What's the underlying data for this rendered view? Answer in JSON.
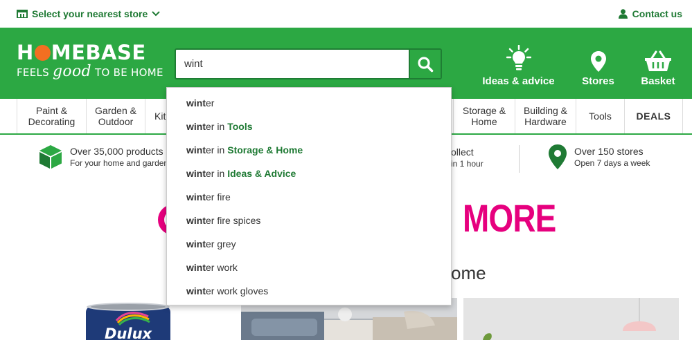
{
  "topbar": {
    "store_select": "Select your nearest store",
    "contact": "Contact us"
  },
  "logo": {
    "brand_h": "H",
    "brand_rest": "MEBASE",
    "tag_feels": "FEELS",
    "tag_good": "good",
    "tag_rest": "TO BE HOME"
  },
  "search": {
    "value": "wint",
    "placeholder": ""
  },
  "header_links": {
    "ideas": "Ideas & advice",
    "stores": "Stores",
    "basket": "Basket"
  },
  "nav": {
    "items": [
      "Paint & Decorating",
      "Garden & Outdoor",
      "Kit",
      "Storage & Home",
      "Building & Hardware",
      "Tools",
      "DEALS"
    ]
  },
  "info": {
    "products_title": "Over 35,000 products",
    "products_sub": "For your home and garden",
    "collect_title": "ollect",
    "collect_sub": "in 1 hour",
    "stores_title": "Over 150 stores",
    "stores_sub": "Open 7 days a week"
  },
  "promo": {
    "more": "MORE",
    "sub": "ome"
  },
  "paint_brand": "Dulux",
  "suggestions": [
    {
      "match": "wint",
      "rest": "er",
      "category": ""
    },
    {
      "match": "wint",
      "rest": "er in",
      "category": "Tools"
    },
    {
      "match": "wint",
      "rest": "er in",
      "category": "Storage & Home"
    },
    {
      "match": "wint",
      "rest": "er in",
      "category": "Ideas & Advice"
    },
    {
      "match": "wint",
      "rest": "er fire",
      "category": ""
    },
    {
      "match": "wint",
      "rest": "er fire spices",
      "category": ""
    },
    {
      "match": "wint",
      "rest": "er grey",
      "category": ""
    },
    {
      "match": "wint",
      "rest": "er work",
      "category": ""
    },
    {
      "match": "wint",
      "rest": "er work gloves",
      "category": ""
    }
  ],
  "colors": {
    "brand_green": "#2ca843",
    "text_green": "#1f7a34",
    "logo_orange": "#f36f21",
    "promo_pink": "#e6007e"
  }
}
